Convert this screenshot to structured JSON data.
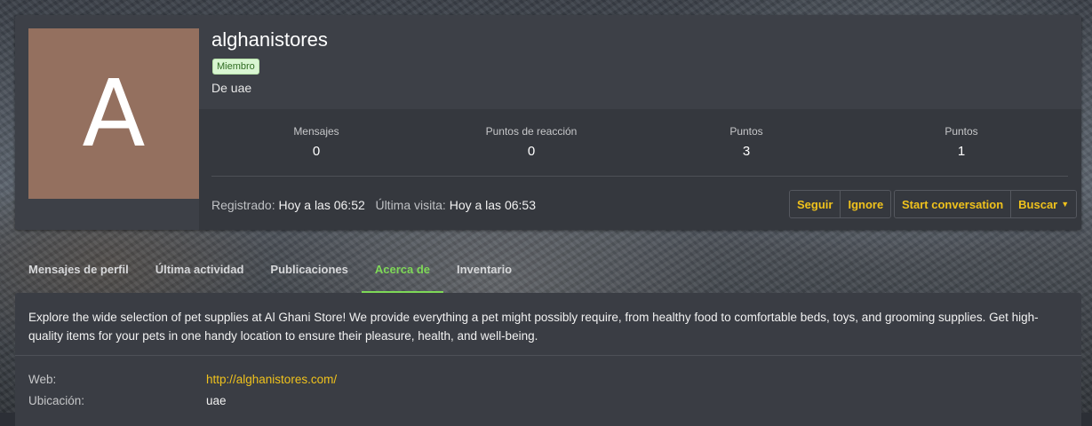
{
  "profile": {
    "avatar_letter": "A",
    "username": "alghanistores",
    "role_badge": "Miembro",
    "location_line": "De uae",
    "stats": [
      {
        "label": "Mensajes",
        "value": "0"
      },
      {
        "label": "Puntos de reacción",
        "value": "0"
      },
      {
        "label": "Puntos",
        "value": "3"
      },
      {
        "label": "Puntos",
        "value": "1"
      }
    ],
    "registered_label": "Registrado:",
    "registered_value": "Hoy a las 06:52",
    "last_seen_label": "Última visita:",
    "last_seen_value": "Hoy a las 06:53",
    "buttons": {
      "follow": "Seguir",
      "ignore": "Ignore",
      "start_conversation": "Start conversation",
      "find": "Buscar"
    }
  },
  "tabs": [
    {
      "label": "Mensajes de perfil",
      "active": false
    },
    {
      "label": "Última actividad",
      "active": false
    },
    {
      "label": "Publicaciones",
      "active": false
    },
    {
      "label": "Acerca de",
      "active": true
    },
    {
      "label": "Inventario",
      "active": false
    }
  ],
  "about": {
    "text": "Explore the wide selection of pet supplies at Al Ghani Store! We provide everything a pet might possibly require, from healthy food to comfortable beds, toys, and grooming supplies. Get high-quality items for your pets in one handy location to ensure their pleasure, health, and well-being.",
    "fields": {
      "website_label": "Web:",
      "website_value": "http://alghanistores.com/",
      "location_label": "Ubicación:",
      "location_value": "uae"
    }
  },
  "colors": {
    "accent": "#f0c21c",
    "active_tab": "#7ed957",
    "avatar_bg": "#94705f",
    "card_bg": "#3d4047"
  }
}
